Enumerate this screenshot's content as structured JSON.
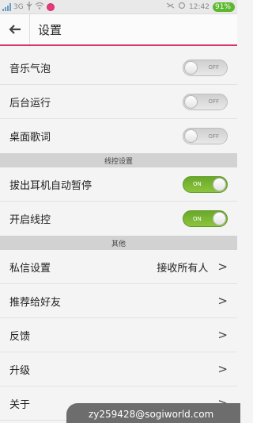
{
  "status_bar": {
    "network": "3G",
    "time": "12:42",
    "battery": "91%"
  },
  "header": {
    "title": "设置"
  },
  "settings": [
    {
      "label": "音乐气泡",
      "toggle": "OFF"
    },
    {
      "label": "后台运行",
      "toggle": "OFF"
    },
    {
      "label": "桌面歌词",
      "toggle": "OFF"
    }
  ],
  "wire_control": {
    "section_title": "线控设置",
    "items": [
      {
        "label": "拔出耳机自动暂停",
        "toggle": "ON"
      },
      {
        "label": "开启线控",
        "toggle": "ON"
      }
    ]
  },
  "other": {
    "section_title": "其他",
    "items": [
      {
        "label": "私信设置",
        "value": "接收所有人",
        "chevron": ">"
      },
      {
        "label": "推荐给好友",
        "chevron": ">"
      },
      {
        "label": "反馈",
        "chevron": ">"
      },
      {
        "label": "升级",
        "chevron": ">"
      },
      {
        "label": "关于",
        "chevron": ">"
      }
    ]
  },
  "toast": {
    "text": "zy259428@sogiworld.com"
  }
}
